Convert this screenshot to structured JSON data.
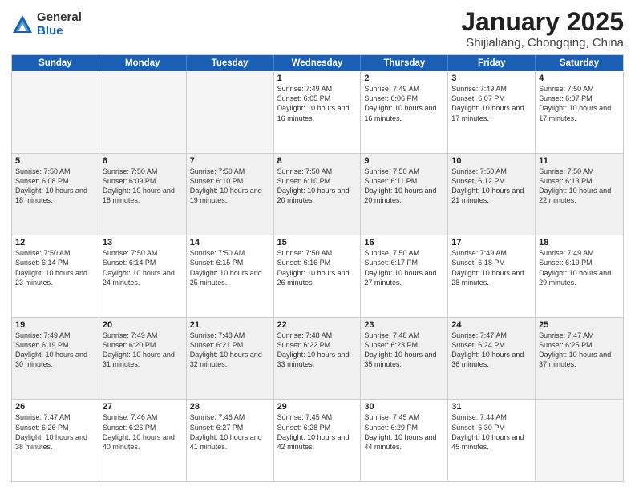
{
  "logo": {
    "general": "General",
    "blue": "Blue"
  },
  "title": "January 2025",
  "subtitle": "Shijialiang, Chongqing, China",
  "weekdays": [
    "Sunday",
    "Monday",
    "Tuesday",
    "Wednesday",
    "Thursday",
    "Friday",
    "Saturday"
  ],
  "weeks": [
    [
      {
        "day": "",
        "info": "",
        "empty": true
      },
      {
        "day": "",
        "info": "",
        "empty": true
      },
      {
        "day": "",
        "info": "",
        "empty": true
      },
      {
        "day": "1",
        "info": "Sunrise: 7:49 AM\nSunset: 6:05 PM\nDaylight: 10 hours\nand 16 minutes.",
        "empty": false,
        "shaded": false
      },
      {
        "day": "2",
        "info": "Sunrise: 7:49 AM\nSunset: 6:06 PM\nDaylight: 10 hours\nand 16 minutes.",
        "empty": false,
        "shaded": false
      },
      {
        "day": "3",
        "info": "Sunrise: 7:49 AM\nSunset: 6:07 PM\nDaylight: 10 hours\nand 17 minutes.",
        "empty": false,
        "shaded": false
      },
      {
        "day": "4",
        "info": "Sunrise: 7:50 AM\nSunset: 6:07 PM\nDaylight: 10 hours\nand 17 minutes.",
        "empty": false,
        "shaded": false
      }
    ],
    [
      {
        "day": "5",
        "info": "Sunrise: 7:50 AM\nSunset: 6:08 PM\nDaylight: 10 hours\nand 18 minutes.",
        "empty": false,
        "shaded": true
      },
      {
        "day": "6",
        "info": "Sunrise: 7:50 AM\nSunset: 6:09 PM\nDaylight: 10 hours\nand 18 minutes.",
        "empty": false,
        "shaded": true
      },
      {
        "day": "7",
        "info": "Sunrise: 7:50 AM\nSunset: 6:10 PM\nDaylight: 10 hours\nand 19 minutes.",
        "empty": false,
        "shaded": true
      },
      {
        "day": "8",
        "info": "Sunrise: 7:50 AM\nSunset: 6:10 PM\nDaylight: 10 hours\nand 20 minutes.",
        "empty": false,
        "shaded": true
      },
      {
        "day": "9",
        "info": "Sunrise: 7:50 AM\nSunset: 6:11 PM\nDaylight: 10 hours\nand 20 minutes.",
        "empty": false,
        "shaded": true
      },
      {
        "day": "10",
        "info": "Sunrise: 7:50 AM\nSunset: 6:12 PM\nDaylight: 10 hours\nand 21 minutes.",
        "empty": false,
        "shaded": true
      },
      {
        "day": "11",
        "info": "Sunrise: 7:50 AM\nSunset: 6:13 PM\nDaylight: 10 hours\nand 22 minutes.",
        "empty": false,
        "shaded": true
      }
    ],
    [
      {
        "day": "12",
        "info": "Sunrise: 7:50 AM\nSunset: 6:14 PM\nDaylight: 10 hours\nand 23 minutes.",
        "empty": false,
        "shaded": false
      },
      {
        "day": "13",
        "info": "Sunrise: 7:50 AM\nSunset: 6:14 PM\nDaylight: 10 hours\nand 24 minutes.",
        "empty": false,
        "shaded": false
      },
      {
        "day": "14",
        "info": "Sunrise: 7:50 AM\nSunset: 6:15 PM\nDaylight: 10 hours\nand 25 minutes.",
        "empty": false,
        "shaded": false
      },
      {
        "day": "15",
        "info": "Sunrise: 7:50 AM\nSunset: 6:16 PM\nDaylight: 10 hours\nand 26 minutes.",
        "empty": false,
        "shaded": false
      },
      {
        "day": "16",
        "info": "Sunrise: 7:50 AM\nSunset: 6:17 PM\nDaylight: 10 hours\nand 27 minutes.",
        "empty": false,
        "shaded": false
      },
      {
        "day": "17",
        "info": "Sunrise: 7:49 AM\nSunset: 6:18 PM\nDaylight: 10 hours\nand 28 minutes.",
        "empty": false,
        "shaded": false
      },
      {
        "day": "18",
        "info": "Sunrise: 7:49 AM\nSunset: 6:19 PM\nDaylight: 10 hours\nand 29 minutes.",
        "empty": false,
        "shaded": false
      }
    ],
    [
      {
        "day": "19",
        "info": "Sunrise: 7:49 AM\nSunset: 6:19 PM\nDaylight: 10 hours\nand 30 minutes.",
        "empty": false,
        "shaded": true
      },
      {
        "day": "20",
        "info": "Sunrise: 7:49 AM\nSunset: 6:20 PM\nDaylight: 10 hours\nand 31 minutes.",
        "empty": false,
        "shaded": true
      },
      {
        "day": "21",
        "info": "Sunrise: 7:48 AM\nSunset: 6:21 PM\nDaylight: 10 hours\nand 32 minutes.",
        "empty": false,
        "shaded": true
      },
      {
        "day": "22",
        "info": "Sunrise: 7:48 AM\nSunset: 6:22 PM\nDaylight: 10 hours\nand 33 minutes.",
        "empty": false,
        "shaded": true
      },
      {
        "day": "23",
        "info": "Sunrise: 7:48 AM\nSunset: 6:23 PM\nDaylight: 10 hours\nand 35 minutes.",
        "empty": false,
        "shaded": true
      },
      {
        "day": "24",
        "info": "Sunrise: 7:47 AM\nSunset: 6:24 PM\nDaylight: 10 hours\nand 36 minutes.",
        "empty": false,
        "shaded": true
      },
      {
        "day": "25",
        "info": "Sunrise: 7:47 AM\nSunset: 6:25 PM\nDaylight: 10 hours\nand 37 minutes.",
        "empty": false,
        "shaded": true
      }
    ],
    [
      {
        "day": "26",
        "info": "Sunrise: 7:47 AM\nSunset: 6:26 PM\nDaylight: 10 hours\nand 38 minutes.",
        "empty": false,
        "shaded": false
      },
      {
        "day": "27",
        "info": "Sunrise: 7:46 AM\nSunset: 6:26 PM\nDaylight: 10 hours\nand 40 minutes.",
        "empty": false,
        "shaded": false
      },
      {
        "day": "28",
        "info": "Sunrise: 7:46 AM\nSunset: 6:27 PM\nDaylight: 10 hours\nand 41 minutes.",
        "empty": false,
        "shaded": false
      },
      {
        "day": "29",
        "info": "Sunrise: 7:45 AM\nSunset: 6:28 PM\nDaylight: 10 hours\nand 42 minutes.",
        "empty": false,
        "shaded": false
      },
      {
        "day": "30",
        "info": "Sunrise: 7:45 AM\nSunset: 6:29 PM\nDaylight: 10 hours\nand 44 minutes.",
        "empty": false,
        "shaded": false
      },
      {
        "day": "31",
        "info": "Sunrise: 7:44 AM\nSunset: 6:30 PM\nDaylight: 10 hours\nand 45 minutes.",
        "empty": false,
        "shaded": false
      },
      {
        "day": "",
        "info": "",
        "empty": true,
        "shaded": false
      }
    ]
  ]
}
